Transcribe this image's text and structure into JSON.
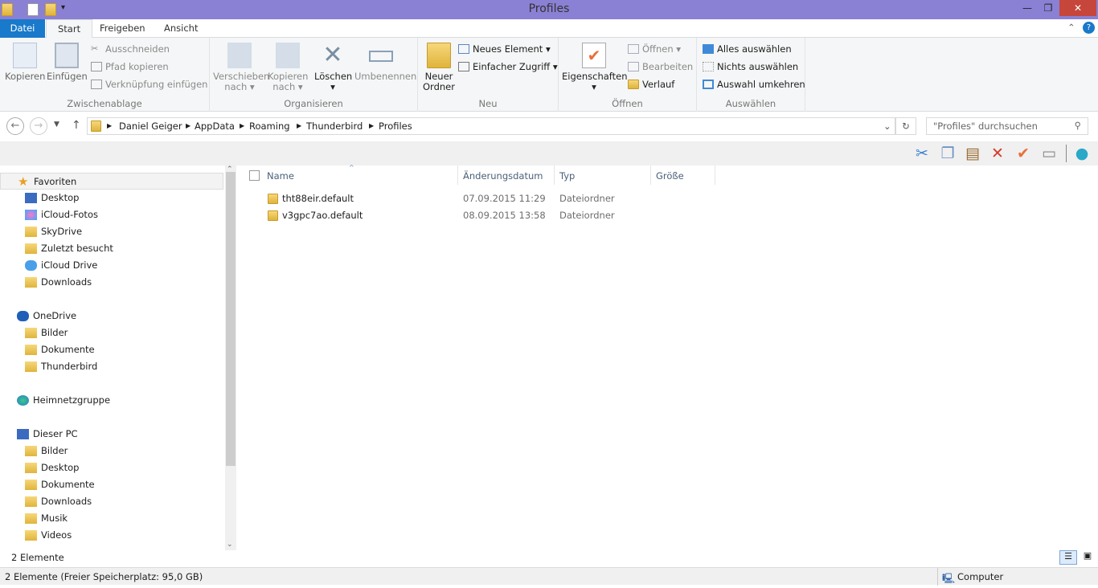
{
  "window": {
    "title": "Profiles"
  },
  "tabs": [
    "Datei",
    "Start",
    "Freigeben",
    "Ansicht"
  ],
  "ribbon": {
    "clipboard": {
      "label": "Zwischenablage",
      "copy": "Kopieren",
      "paste": "Einfügen",
      "cut": "Ausschneiden",
      "copy_path": "Pfad kopieren",
      "paste_shortcut": "Verknüpfung einfügen"
    },
    "organize": {
      "label": "Organisieren",
      "move_to": "Verschieben",
      "move_to2": "nach",
      "copy_to": "Kopieren",
      "copy_to2": "nach",
      "delete": "Löschen",
      "rename": "Umbenennen"
    },
    "new": {
      "label": "Neu",
      "new_folder": "Neuer",
      "new_folder2": "Ordner",
      "new_item": "Neues Element",
      "easy_access": "Einfacher Zugriff"
    },
    "open": {
      "label": "Öffnen",
      "properties": "Eigenschaften",
      "open": "Öffnen",
      "edit": "Bearbeiten",
      "history": "Verlauf"
    },
    "select": {
      "label": "Auswählen",
      "select_all": "Alles auswählen",
      "select_none": "Nichts auswählen",
      "invert": "Auswahl umkehren"
    }
  },
  "address": {
    "path": [
      "Daniel Geiger",
      "AppData",
      "Roaming",
      "Thunderbird",
      "Profiles"
    ],
    "search_placeholder": "\"Profiles\" durchsuchen"
  },
  "nav": [
    {
      "label": "Favoriten",
      "level": 0,
      "icon": "star"
    },
    {
      "label": "Desktop",
      "level": 1,
      "icon": "desktop"
    },
    {
      "label": "iCloud-Fotos",
      "level": 1,
      "icon": "photos"
    },
    {
      "label": "SkyDrive",
      "level": 1,
      "icon": "folder"
    },
    {
      "label": "Zuletzt besucht",
      "level": 1,
      "icon": "recent"
    },
    {
      "label": "iCloud Drive",
      "level": 1,
      "icon": "cloud"
    },
    {
      "label": "Downloads",
      "level": 1,
      "icon": "downloads"
    },
    {
      "label": "OneDrive",
      "level": 0,
      "icon": "onedrive"
    },
    {
      "label": "Bilder",
      "level": 1,
      "icon": "folder"
    },
    {
      "label": "Dokumente",
      "level": 1,
      "icon": "folder"
    },
    {
      "label": "Thunderbird",
      "level": 1,
      "icon": "folder"
    },
    {
      "label": "Heimnetzgruppe",
      "level": 0,
      "icon": "homegroup"
    },
    {
      "label": "Dieser PC",
      "level": 0,
      "icon": "pc"
    },
    {
      "label": "Bilder",
      "level": 1,
      "icon": "folder"
    },
    {
      "label": "Desktop",
      "level": 1,
      "icon": "folder"
    },
    {
      "label": "Dokumente",
      "level": 1,
      "icon": "folder"
    },
    {
      "label": "Downloads",
      "level": 1,
      "icon": "folder"
    },
    {
      "label": "Musik",
      "level": 1,
      "icon": "folder"
    },
    {
      "label": "Videos",
      "level": 1,
      "icon": "folder"
    }
  ],
  "columns": [
    "Name",
    "Änderungsdatum",
    "Typ",
    "Größe"
  ],
  "files": [
    {
      "name": "tht88eir.default",
      "date": "07.09.2015 11:29",
      "type": "Dateiordner"
    },
    {
      "name": "v3gpc7ao.default",
      "date": "08.09.2015 13:58",
      "type": "Dateiordner"
    }
  ],
  "status": {
    "count": "2 Elemente",
    "bottom": "2 Elemente (Freier Speicherplatz: 95,0 GB)",
    "location": "Computer"
  }
}
